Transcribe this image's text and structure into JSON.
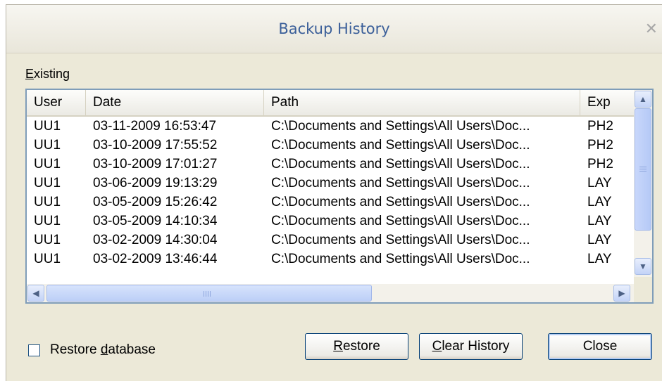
{
  "window": {
    "title": "Backup History"
  },
  "existing": {
    "label_accel": "E",
    "label_rest": "xisting",
    "columns": {
      "user": "User",
      "date": "Date",
      "path": "Path",
      "exp": "Exp"
    },
    "rows": [
      {
        "user": "UU1",
        "date": "03-11-2009 16:53:47",
        "path": "C:\\Documents and Settings\\All Users\\Doc...",
        "exp": "PH2"
      },
      {
        "user": "UU1",
        "date": "03-10-2009 17:55:52",
        "path": "C:\\Documents and Settings\\All Users\\Doc...",
        "exp": "PH2"
      },
      {
        "user": "UU1",
        "date": "03-10-2009 17:01:27",
        "path": "C:\\Documents and Settings\\All Users\\Doc...",
        "exp": "PH2"
      },
      {
        "user": "UU1",
        "date": "03-06-2009 19:13:29",
        "path": "C:\\Documents and Settings\\All Users\\Doc...",
        "exp": "LAY"
      },
      {
        "user": "UU1",
        "date": "03-05-2009 15:26:42",
        "path": "C:\\Documents and Settings\\All Users\\Doc...",
        "exp": "LAY"
      },
      {
        "user": "UU1",
        "date": "03-05-2009 14:10:34",
        "path": "C:\\Documents and Settings\\All Users\\Doc...",
        "exp": "LAY"
      },
      {
        "user": "UU1",
        "date": "03-02-2009 14:30:04",
        "path": "C:\\Documents and Settings\\All Users\\Doc...",
        "exp": "LAY"
      },
      {
        "user": "UU1",
        "date": "03-02-2009 13:46:44",
        "path": "C:\\Documents and Settings\\All Users\\Doc...",
        "exp": "LAY"
      }
    ]
  },
  "restore_database": {
    "checked": false,
    "label_pre": "Restore ",
    "label_accel": "d",
    "label_post": "atabase"
  },
  "buttons": {
    "restore": {
      "accel": "R",
      "rest": "estore"
    },
    "clear_history": {
      "accel": "C",
      "rest": "lear History"
    },
    "close": {
      "label": "Close"
    }
  },
  "icons": {
    "close": "close-icon",
    "scroll_up": "arrow-up-icon",
    "scroll_down": "arrow-down-icon",
    "scroll_left": "arrow-left-icon",
    "scroll_right": "arrow-right-icon"
  },
  "colors": {
    "title_text": "#3b5f99",
    "dialog_bg": "#ece9d8",
    "list_border": "#7f9db9",
    "scrollbar_thumb": "#c1d3fb",
    "button_border": "#003c74"
  }
}
